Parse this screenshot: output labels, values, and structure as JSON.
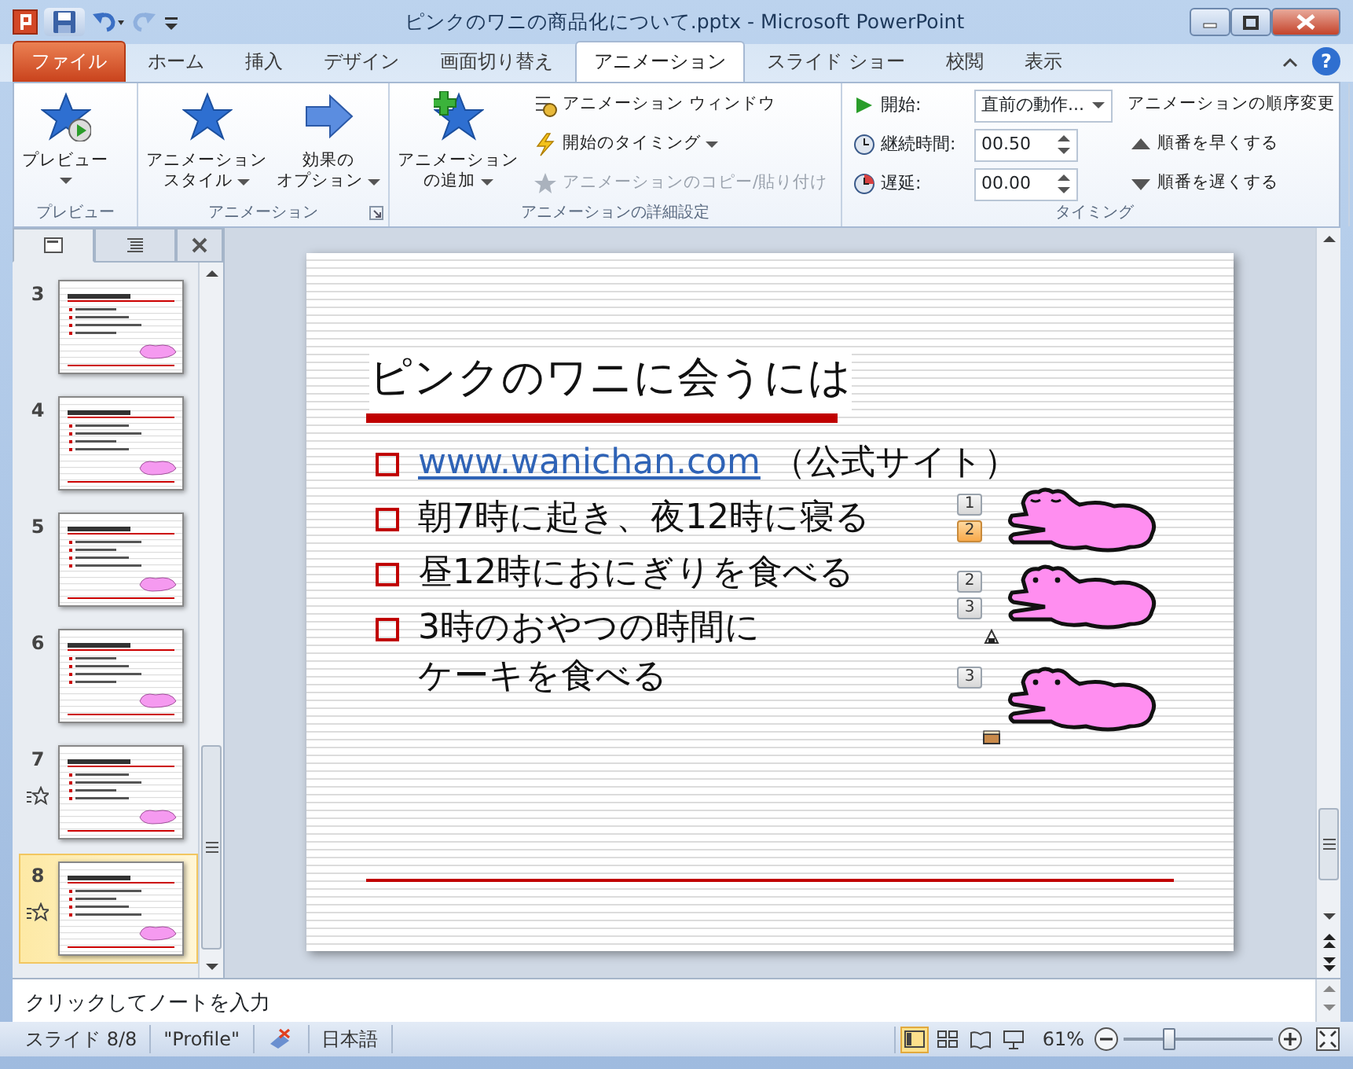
{
  "window": {
    "title": "ピンクのワニの商品化について.pptx - Microsoft PowerPoint"
  },
  "tabs": [
    {
      "label": "ファイル",
      "kind": "file",
      "selected": false
    },
    {
      "label": "ホーム",
      "kind": "tab",
      "selected": false
    },
    {
      "label": "挿入",
      "kind": "tab",
      "selected": false
    },
    {
      "label": "デザイン",
      "kind": "tab",
      "selected": false
    },
    {
      "label": "画面切り替え",
      "kind": "tab",
      "selected": false
    },
    {
      "label": "アニメーション",
      "kind": "tab",
      "selected": true
    },
    {
      "label": "スライド ショー",
      "kind": "tab",
      "selected": false
    },
    {
      "label": "校閲",
      "kind": "tab",
      "selected": false
    },
    {
      "label": "表示",
      "kind": "tab",
      "selected": false
    }
  ],
  "help": "?",
  "ribbon": [
    {
      "label": "プレビュー",
      "launcher": false,
      "items": [
        {
          "kind": "large",
          "lines": [
            "プレビュー"
          ],
          "dropdown": true
        }
      ]
    },
    {
      "label": "アニメーション",
      "launcher": true,
      "items": [
        {
          "kind": "large",
          "lines": [
            "アニメーション",
            "スタイル"
          ],
          "dropdown": true
        },
        {
          "kind": "large",
          "lines": [
            "効果の",
            "オプション"
          ],
          "dropdown": true
        }
      ]
    },
    {
      "label": "アニメーションの詳細設定",
      "launcher": false,
      "items": [
        {
          "kind": "large",
          "lines": [
            "アニメーション",
            "の追加"
          ],
          "dropdown": true
        },
        {
          "kind": "small",
          "label": "アニメーション ウィンドウ",
          "dropdown": false,
          "disabled": false
        },
        {
          "kind": "small",
          "label": "開始のタイミング",
          "dropdown": true,
          "disabled": false
        },
        {
          "kind": "small",
          "label": "アニメーションのコピー/貼り付け",
          "dropdown": false,
          "disabled": true
        }
      ]
    },
    {
      "label": "タイミング",
      "launcher": false,
      "items": [
        {
          "kind": "select",
          "label": "開始:",
          "value": "直前の動作..."
        },
        {
          "kind": "spin",
          "label": "継続時間:",
          "value": "00.50"
        },
        {
          "kind": "spin",
          "label": "遅延:",
          "value": "00.00"
        },
        {
          "kind": "heading",
          "label": "アニメーションの順序変更"
        },
        {
          "kind": "small",
          "label": "順番を早くする",
          "dropdown": false,
          "disabled": false
        },
        {
          "kind": "small",
          "label": "順番を遅くする",
          "dropdown": false,
          "disabled": false
        }
      ]
    }
  ],
  "pane_tabs": [
    {
      "kind": "slides",
      "selected": true
    },
    {
      "kind": "outline",
      "selected": false
    }
  ],
  "thumbnails": [
    {
      "number": "3",
      "animated": false,
      "selected": false
    },
    {
      "number": "4",
      "animated": false,
      "selected": false
    },
    {
      "number": "5",
      "animated": false,
      "selected": false
    },
    {
      "number": "6",
      "animated": false,
      "selected": false
    },
    {
      "number": "7",
      "animated": true,
      "selected": false
    },
    {
      "number": "8",
      "animated": true,
      "selected": true
    }
  ],
  "slide": {
    "title": "ピンクのワニに会うには",
    "bullets": [
      {
        "link": "www.wanichan.com",
        "lines": [
          "（公式サイト）"
        ]
      },
      {
        "lines": [
          "朝7時に起き、夜12時に寝る"
        ]
      },
      {
        "lines": [
          "昼12時におにぎりを食べる"
        ]
      },
      {
        "lines": [
          "3時のおやつの時間に",
          "ケーキを食べる"
        ]
      }
    ],
    "crocodiles": [
      {
        "eyes_closed": true,
        "tags": [
          {
            "label": "1",
            "selected": false
          },
          {
            "label": "2",
            "selected": true
          }
        ]
      },
      {
        "eyes_closed": false,
        "tags": [
          {
            "label": "2",
            "selected": false
          },
          {
            "label": "3",
            "selected": false
          }
        ]
      },
      {
        "eyes_closed": false,
        "tags": [
          {
            "label": "3",
            "selected": false
          }
        ]
      }
    ]
  },
  "notes": {
    "placeholder": "クリックしてノートを入力"
  },
  "status_bar": {
    "slide": "スライド 8/8",
    "theme": "\"Profile\"",
    "language": "日本語",
    "views": [
      {
        "selected": true
      },
      {
        "selected": false
      },
      {
        "selected": false
      },
      {
        "selected": false
      }
    ],
    "zoom": "61%",
    "zoom_slider": {
      "level": 0.3
    }
  }
}
